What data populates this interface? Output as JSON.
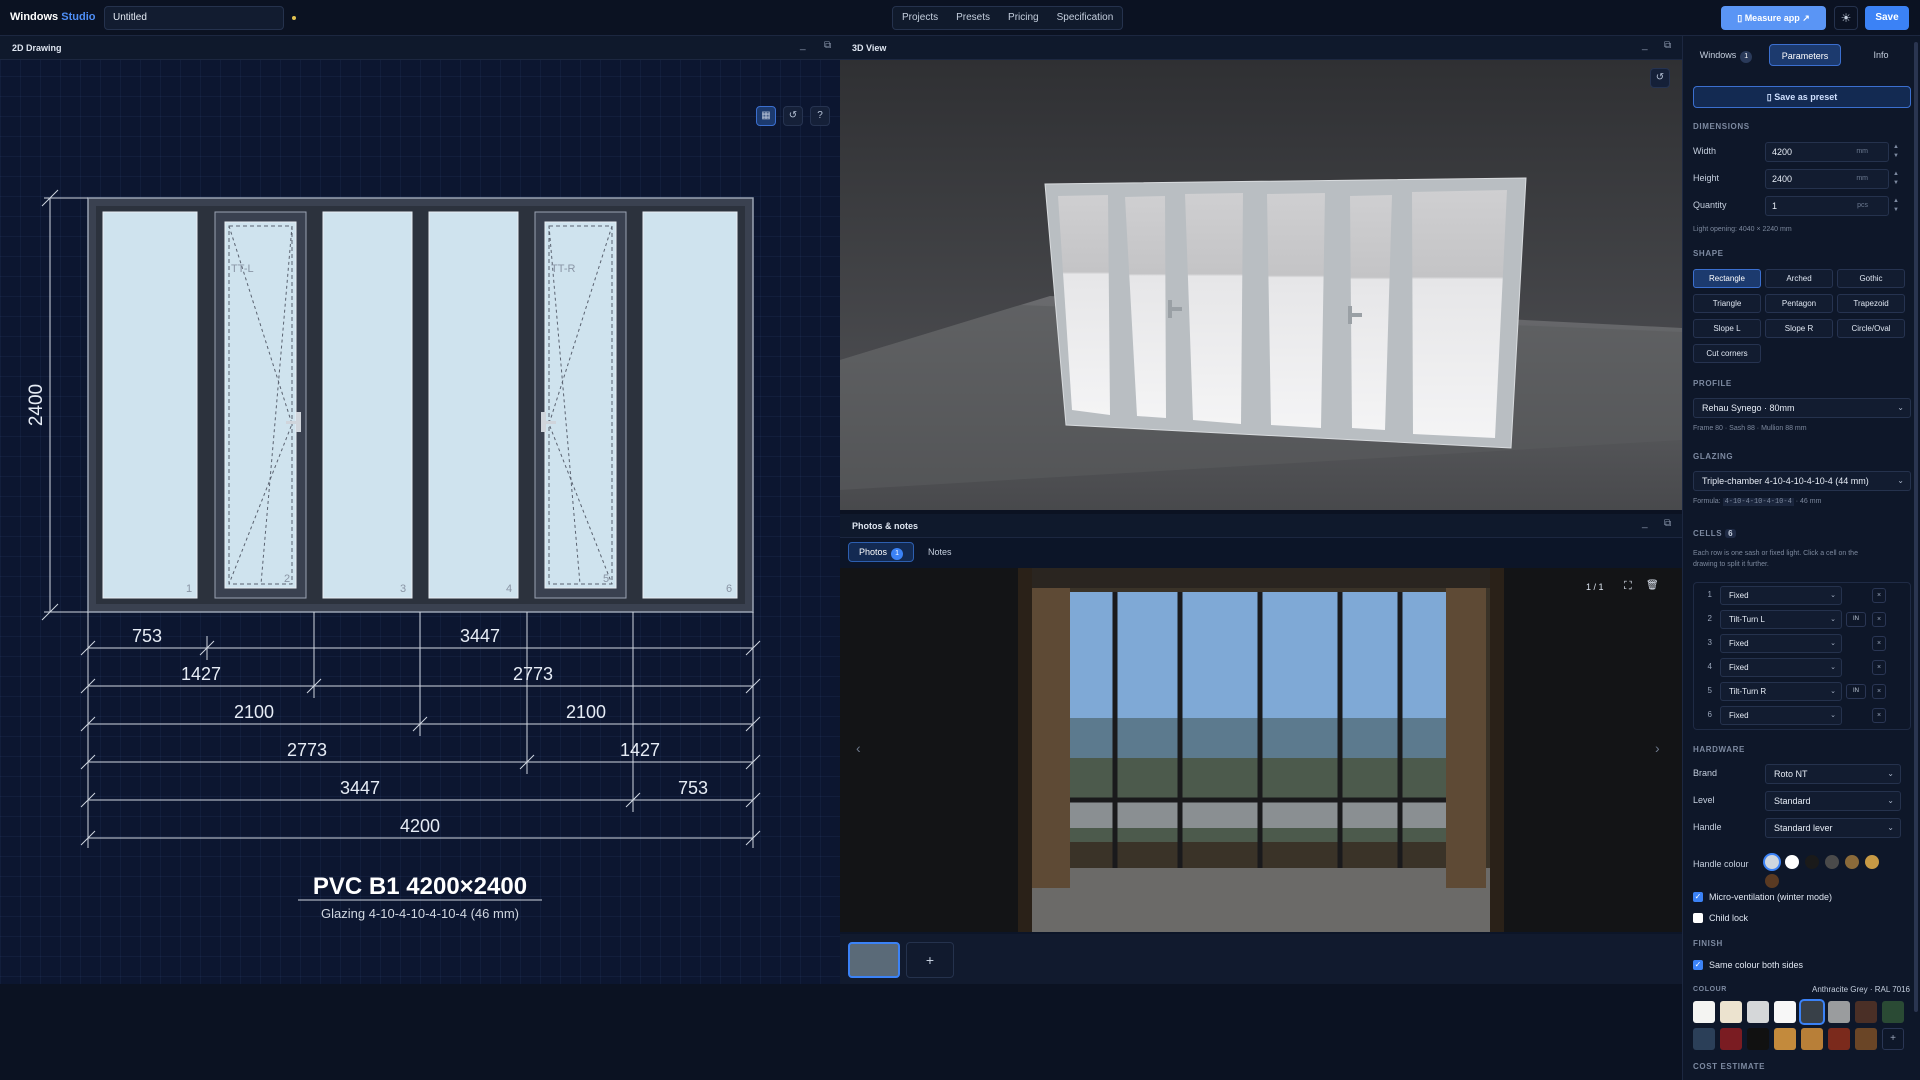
{
  "app": {
    "brand_prefix": "Windows",
    "brand_suffix": "Studio",
    "doc_title": "Untitled"
  },
  "nav": [
    "Projects",
    "Presets",
    "Pricing",
    "Specification"
  ],
  "toolbar": {
    "measure_label": "Measure app",
    "save_label": "Save"
  },
  "panels": {
    "drawing_title": "2D Drawing",
    "view3d_title": "3D View",
    "photos_title": "Photos & notes"
  },
  "drawing": {
    "height_dim": "2400",
    "sash_labels": [
      "TT-L",
      "TT-R"
    ],
    "cell_numbers": [
      "1",
      "2",
      "3",
      "4",
      "5",
      "6"
    ],
    "dim_rows": [
      [
        "753",
        "3447"
      ],
      [
        "1427",
        "2773"
      ],
      [
        "2100",
        "2100"
      ],
      [
        "2773",
        "1427"
      ],
      [
        "3447",
        "753"
      ],
      [
        "4200"
      ]
    ],
    "caption": "PVC B1 4200×2400",
    "subcaption": "Glazing 4-10-4-10-4-10-4 (46 mm)"
  },
  "photos": {
    "tab_photos": "Photos",
    "photos_count": "1",
    "tab_notes": "Notes",
    "counter": "1 / 1",
    "add_label": "+"
  },
  "sidebar": {
    "tabs": {
      "windows": "Windows",
      "windows_count": "1",
      "parameters": "Parameters",
      "info": "Info"
    },
    "save_preset": "Save as preset",
    "dimensions": {
      "section": "DIMENSIONS",
      "width_label": "Width",
      "width_value": "4200",
      "width_unit": "mm",
      "height_label": "Height",
      "height_value": "2400",
      "height_unit": "mm",
      "qty_label": "Quantity",
      "qty_value": "1",
      "qty_unit": "pcs",
      "light_opening": "Light opening: 4040 × 2240 mm"
    },
    "shape": {
      "section": "SHAPE",
      "options": [
        "Rectangle",
        "Arched",
        "Gothic",
        "Triangle",
        "Pentagon",
        "Trapezoid",
        "Slope L",
        "Slope R",
        "Circle/Oval",
        "Cut corners"
      ],
      "selected": "Rectangle"
    },
    "profile": {
      "section": "PROFILE",
      "value": "Rehau Synego · 80mm",
      "hint": "Frame 80 · Sash 88 · Mullion 88 mm"
    },
    "glazing": {
      "section": "GLAZING",
      "value": "Triple-chamber 4-10-4-10-4-10-4 (44 mm)",
      "formula_label": "Formula:",
      "formula": "4-10-4-10-4-10-4",
      "formula_thickness": "· 46 mm"
    },
    "cells": {
      "section": "CELLS",
      "count": "6",
      "hint1": "Each row is one sash or fixed light. Click a cell on the",
      "hint2": "drawing to split it further.",
      "rows": [
        {
          "num": "1",
          "type": "Fixed",
          "dir": ""
        },
        {
          "num": "2",
          "type": "Tilt-Turn L",
          "dir": "IN"
        },
        {
          "num": "3",
          "type": "Fixed",
          "dir": ""
        },
        {
          "num": "4",
          "type": "Fixed",
          "dir": ""
        },
        {
          "num": "5",
          "type": "Tilt-Turn R",
          "dir": "IN"
        },
        {
          "num": "6",
          "type": "Fixed",
          "dir": ""
        }
      ]
    },
    "hardware": {
      "section": "HARDWARE",
      "brand_label": "Brand",
      "brand_value": "Roto NT",
      "level_label": "Level",
      "level_value": "Standard",
      "handle_label": "Handle",
      "handle_value": "Standard lever",
      "handle_colour_label": "Handle colour",
      "handle_colours": [
        "#cfd6de",
        "#ffffff",
        "#1a1a1a",
        "#4a4a4a",
        "#8a6a3a",
        "#c79a45",
        "#5a3a22"
      ],
      "micro_vent": "Micro-ventilation (winter mode)",
      "child_lock": "Child lock"
    },
    "finish": {
      "section": "FINISH",
      "same_colour": "Same colour both sides",
      "colour_label": "COLOUR",
      "colour_value": "Anthracite Grey · RAL 7016",
      "swatches": [
        "#f4f4f2",
        "#ece3cf",
        "#d5d7d9",
        "#f7f7f7",
        "#384048",
        "#9a9c9e",
        "#4a2f26",
        "#2a4a34",
        "#2b3f58",
        "#7a1c22",
        "#111111",
        "#c38a3c",
        "#b87f38",
        "#7b2a1c",
        "#6a4526"
      ],
      "more_label": "+"
    },
    "cost": {
      "section": "COST ESTIMATE"
    }
  }
}
